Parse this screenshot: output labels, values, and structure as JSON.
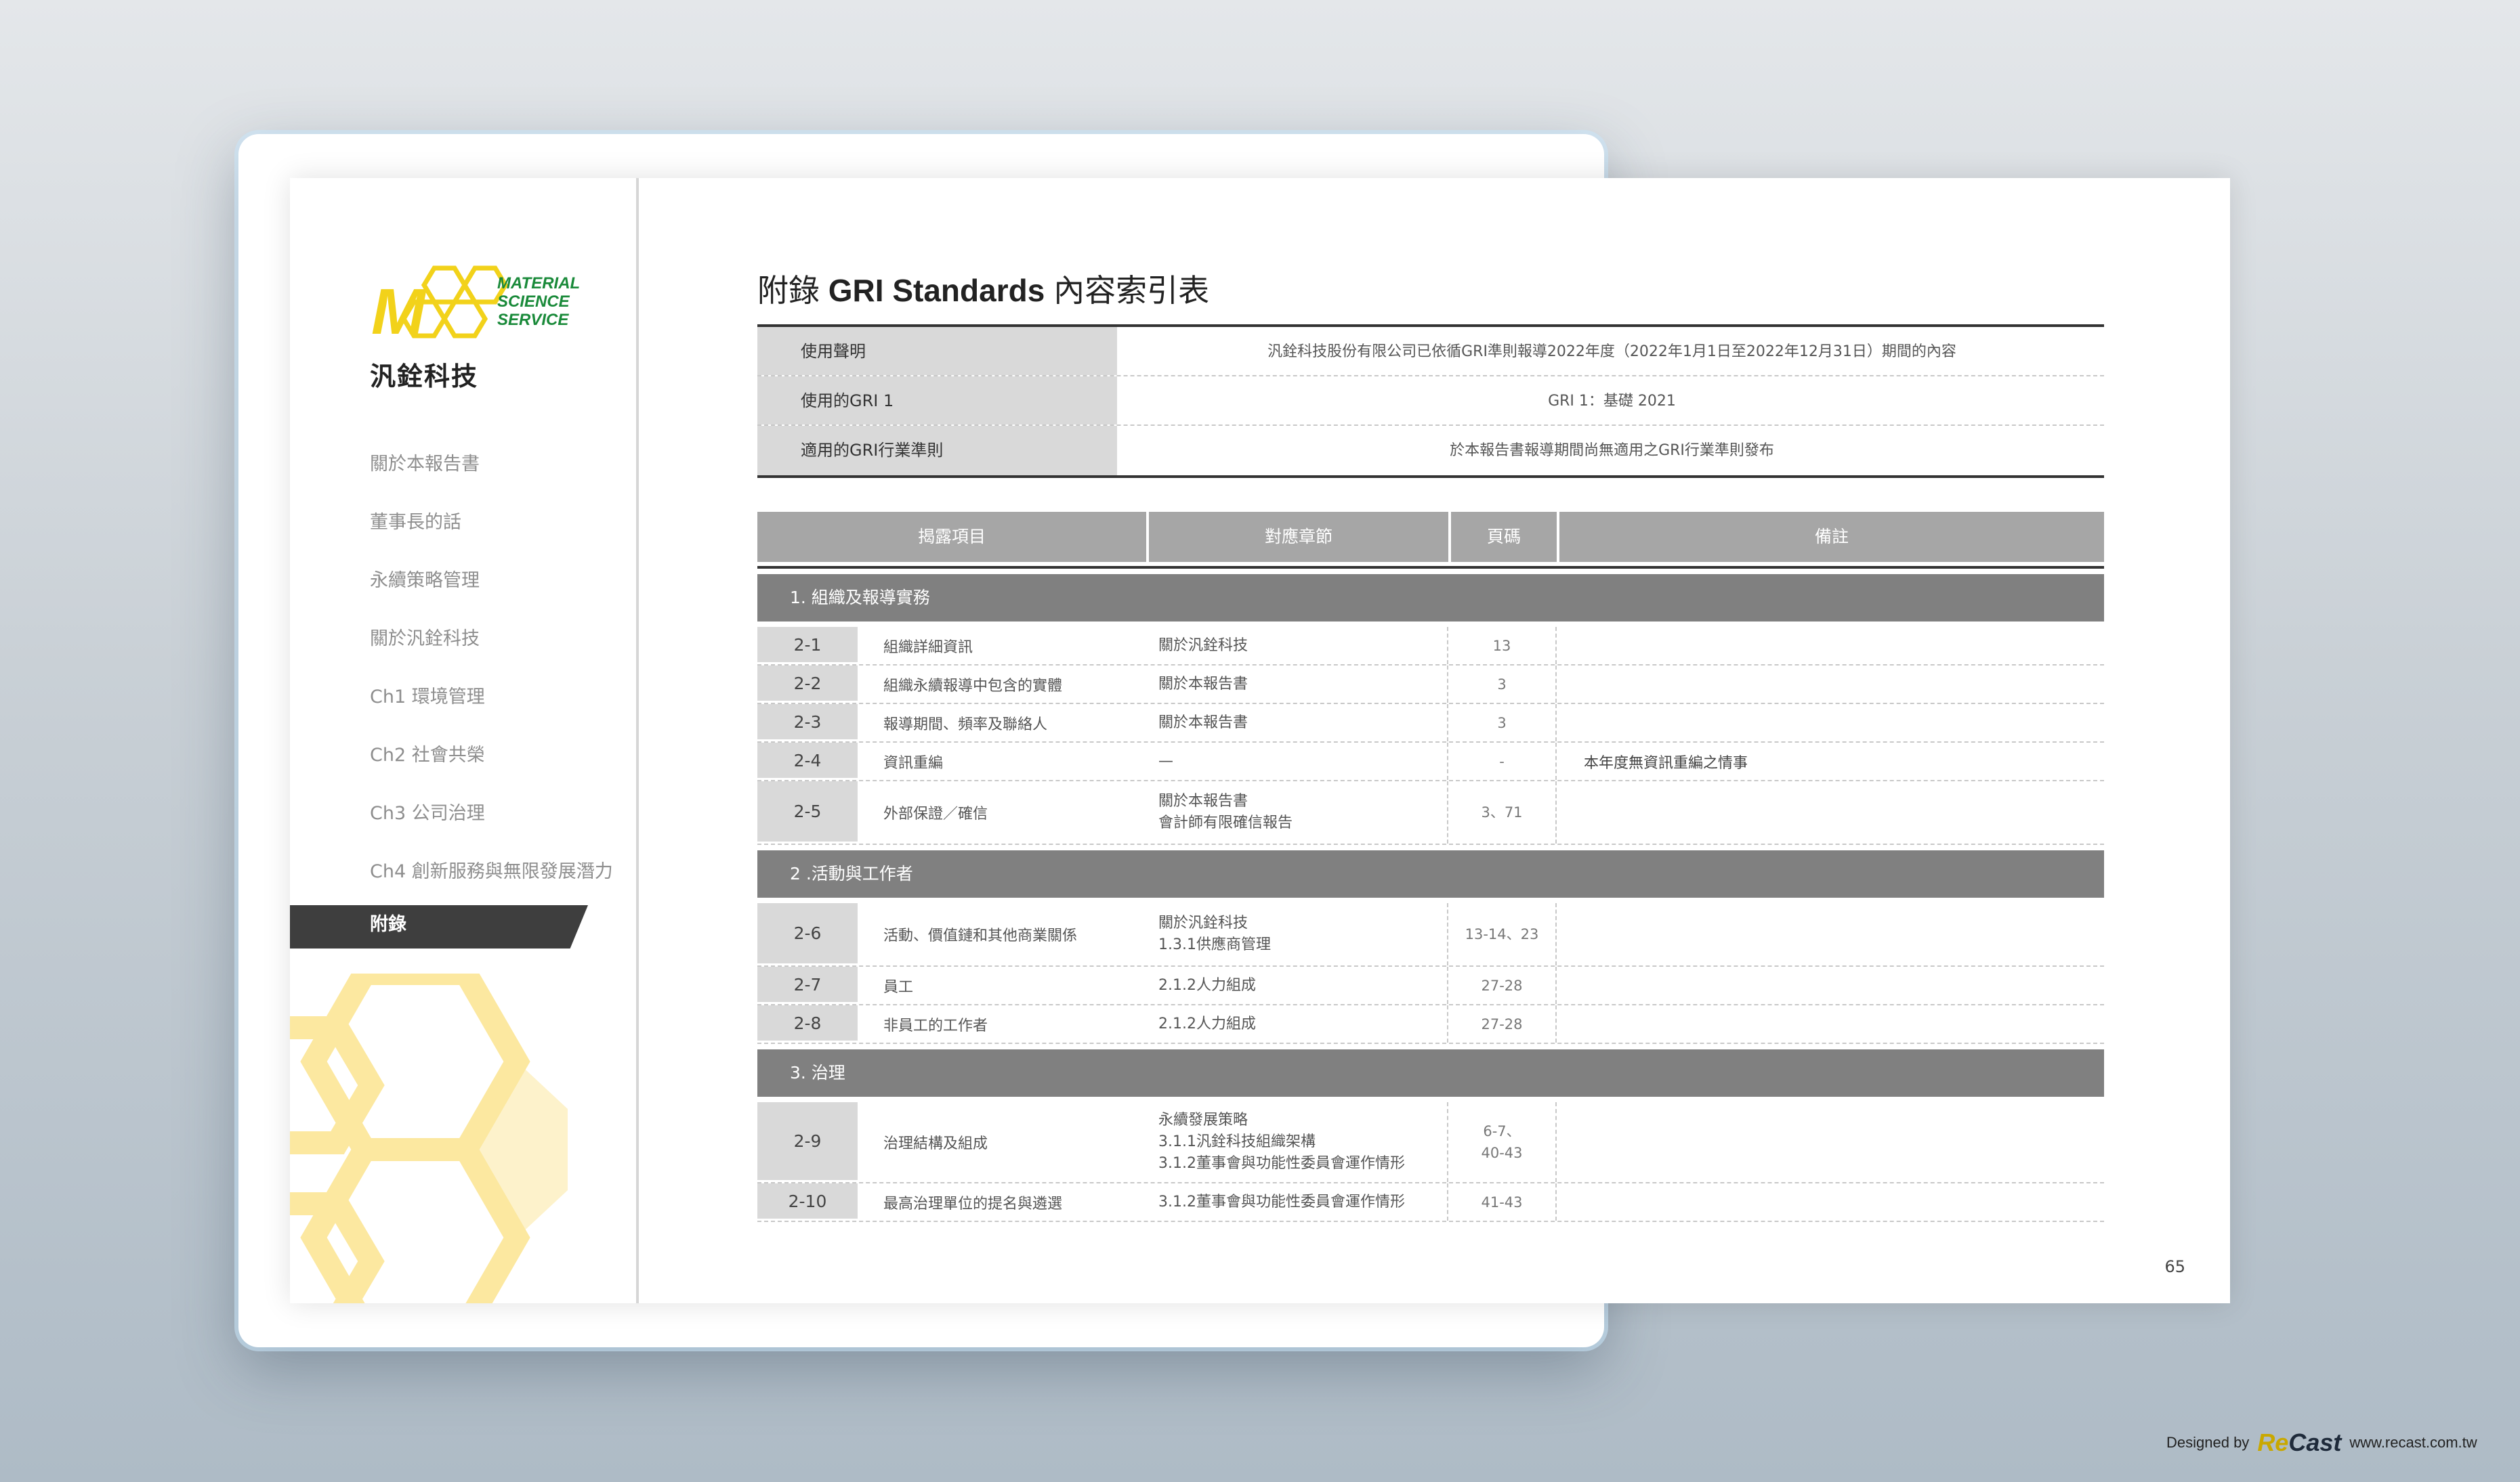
{
  "brand": {
    "logo_text_lines": [
      "MATERIAL",
      "SCIENCE",
      "SERVICE"
    ],
    "logo_letter": "M",
    "company_name": "汎銓科技"
  },
  "nav": {
    "items": [
      {
        "label": "關於本報告書"
      },
      {
        "label": "董事長的話"
      },
      {
        "label": "永續策略管理"
      },
      {
        "label": "關於汎銓科技"
      },
      {
        "label": "Ch1 環境管理"
      },
      {
        "label": "Ch2 社會共榮"
      },
      {
        "label": "Ch3 公司治理"
      },
      {
        "label": "Ch4 創新服務與無限發展潛力"
      },
      {
        "label": "附錄",
        "active": true
      }
    ]
  },
  "page": {
    "title_prefix": "附錄",
    "title_bold": "GRI Standards",
    "title_suffix": "內容索引表",
    "page_number": "65"
  },
  "info": [
    {
      "label": "使用聲明",
      "value": "汎銓科技股份有限公司已依循GRI準則報導2022年度（2022年1月1日至2022年12月31日）期間的內容"
    },
    {
      "label": "使用的GRI 1",
      "value": "GRI 1：基礎 2021"
    },
    {
      "label": "適用的GRI行業準則",
      "value": "於本報告書報導期間尚無適用之GRI行業準則發布"
    }
  ],
  "table": {
    "headers": [
      "揭露項目",
      "對應章節",
      "頁碼",
      "備註"
    ],
    "sections": [
      {
        "title": "1. 組織及報導實務",
        "rows": [
          {
            "no": "2-1",
            "item": "組織詳細資訊",
            "chapter": "關於汎銓科技",
            "page": "13",
            "note": ""
          },
          {
            "no": "2-2",
            "item": "組織永續報導中包含的實體",
            "chapter": "關於本報告書",
            "page": "3",
            "note": ""
          },
          {
            "no": "2-3",
            "item": "報導期間、頻率及聯絡人",
            "chapter": "關於本報告書",
            "page": "3",
            "note": ""
          },
          {
            "no": "2-4",
            "item": "資訊重編",
            "chapter": "—",
            "page": "-",
            "note": "本年度無資訊重編之情事"
          },
          {
            "no": "2-5",
            "item": "外部保證／確信",
            "chapter": "關於本報告書\n會計師有限確信報告",
            "page": "3、71",
            "note": ""
          }
        ]
      },
      {
        "title": "2 .活動與工作者",
        "rows": [
          {
            "no": "2-6",
            "item": "活動、價值鏈和其他商業關係",
            "chapter": "關於汎銓科技\n1.3.1供應商管理",
            "page": "13-14、23",
            "note": ""
          },
          {
            "no": "2-7",
            "item": "員工",
            "chapter": "2.1.2人力組成",
            "page": "27-28",
            "note": ""
          },
          {
            "no": "2-8",
            "item": "非員工的工作者",
            "chapter": "2.1.2人力組成",
            "page": "27-28",
            "note": ""
          }
        ]
      },
      {
        "title": "3. 治理",
        "rows": [
          {
            "no": "2-9",
            "item": "治理結構及組成",
            "chapter": "永續發展策略\n3.1.1汎銓科技組織架構\n3.1.2董事會與功能性委員會運作情形",
            "page": "6-7、\n40-43",
            "note": ""
          },
          {
            "no": "2-10",
            "item": "最高治理單位的提名與遴選",
            "chapter": "3.1.2董事會與功能性委員會運作情形",
            "page": "41-43",
            "note": ""
          }
        ]
      }
    ]
  },
  "credit": {
    "designed_by": "Designed by",
    "brand_a": "Re",
    "brand_b": "Cast",
    "url": "www.recast.com.tw"
  },
  "colors": {
    "logo_yellow": "#f2d21a",
    "logo_green": "#1a8a3a",
    "header_gray": "#a6a6a6",
    "section_gray": "#808080",
    "label_gray": "#d9d9d9",
    "hex_yellow": "#fce8a0"
  }
}
